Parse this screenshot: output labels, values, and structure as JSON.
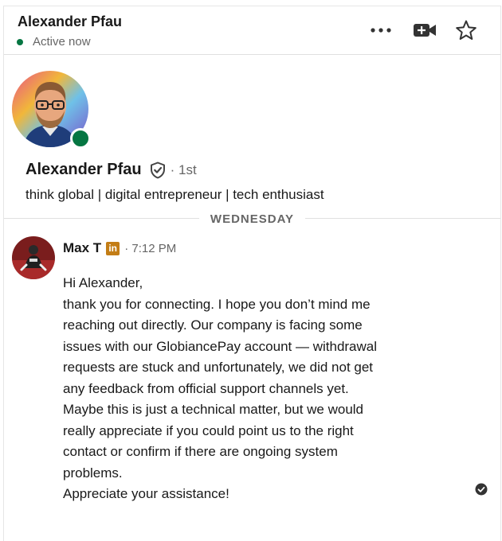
{
  "header": {
    "name": "Alexander Pfau",
    "status": "Active now",
    "icons": [
      "more-icon",
      "video-call-icon",
      "star-icon"
    ]
  },
  "profile": {
    "name": "Alexander Pfau",
    "degree": "· 1st",
    "headline": "think global | digital entrepreneur | tech enthusiast"
  },
  "divider": {
    "label": "WEDNESDAY"
  },
  "message": {
    "sender": "Max T",
    "badge": "in",
    "time": "· 7:12 PM",
    "lines": [
      "Hi Alexander,",
      "thank you for connecting. I hope you don’t mind me",
      "reaching out directly. Our company is facing some",
      "issues with our GlobiancePay account — withdrawal",
      "requests are stuck and unfortunately, we did not get",
      "any feedback from official support channels yet.",
      "Maybe this is just a technical matter, but we would",
      "really appreciate if you could point us to the right",
      "contact or confirm if there are ongoing system",
      "problems.",
      "Appreciate your assistance!"
    ]
  },
  "colors": {
    "presence_green": "#057642",
    "linkedin_premium_badge": "#c37d16",
    "muted_text": "#666666"
  }
}
